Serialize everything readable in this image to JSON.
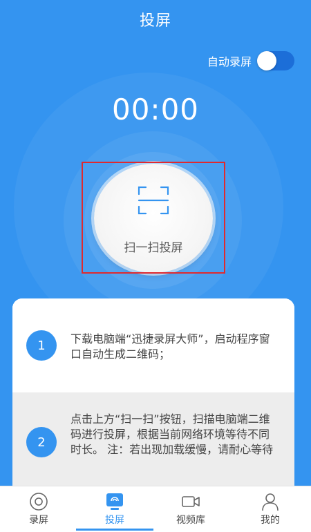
{
  "header": {
    "title": "投屏"
  },
  "auto_record": {
    "label": "自动录屏",
    "enabled": true
  },
  "timer": {
    "value": "00:00"
  },
  "scan": {
    "label": "扫一扫投屏",
    "icon": "scan-frame-icon"
  },
  "steps": [
    {
      "number": "1",
      "text": "下载电脑端“迅捷录屏大师”，启动程序窗口自动生成二维码；"
    },
    {
      "number": "2",
      "text": "点击上方“扫一扫”按钮，扫描电脑端二维码进行投屏，根据当前网络环境等待不同时长。 注：若出现加载缓慢，请耐心等待"
    }
  ],
  "tabs": [
    {
      "label": "录屏",
      "icon": "record-icon",
      "active": false
    },
    {
      "label": "投屏",
      "icon": "cast-icon",
      "active": true
    },
    {
      "label": "视频库",
      "icon": "video-library-icon",
      "active": false
    },
    {
      "label": "我的",
      "icon": "profile-icon",
      "active": false
    }
  ],
  "colors": {
    "primary": "#3494f0",
    "highlight": "#e0292e",
    "step_alt_bg": "#ededed"
  }
}
